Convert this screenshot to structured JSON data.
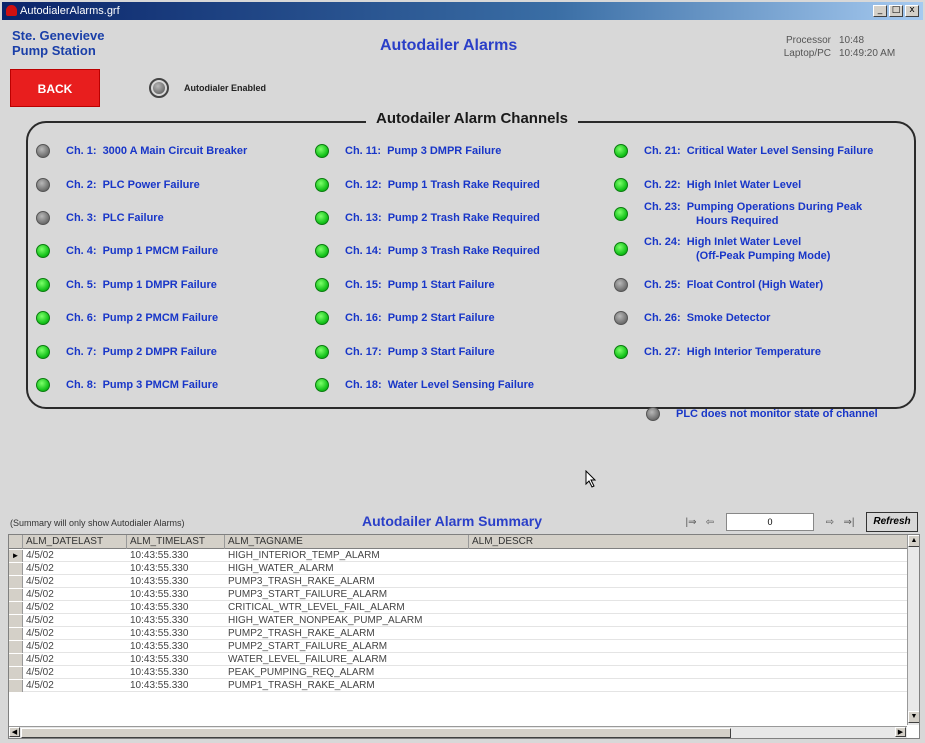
{
  "window": {
    "title": "AutodialerAlarms.grf",
    "min_label": "_",
    "max_label": "□",
    "close_label": "x"
  },
  "header": {
    "station_line1": "Ste. Genevieve",
    "station_line2": "Pump Station",
    "title": "Autodailer Alarms",
    "processor_label": "Processor",
    "laptop_label": "Laptop/PC",
    "processor_time": "10:48",
    "laptop_time": "10:49:20 AM"
  },
  "controls": {
    "back_label": "BACK",
    "enabled_label": "Autodialer Enabled"
  },
  "panel": {
    "title": "Autodailer Alarm Channels",
    "legend_text": "PLC does not monitor state of channel",
    "channels": [
      {
        "num": "Ch. 1:",
        "label": "3000 A Main Circuit Breaker",
        "state": "grey"
      },
      {
        "num": "Ch. 2:",
        "label": "PLC Power Failure",
        "state": "grey"
      },
      {
        "num": "Ch. 3:",
        "label": "PLC Failure",
        "state": "grey"
      },
      {
        "num": "Ch. 4:",
        "label": "Pump 1 PMCM Failure",
        "state": "green"
      },
      {
        "num": "Ch. 5:",
        "label": "Pump 1 DMPR Failure",
        "state": "green"
      },
      {
        "num": "Ch. 6:",
        "label": "Pump 2 PMCM Failure",
        "state": "green"
      },
      {
        "num": "Ch. 7:",
        "label": "Pump 2 DMPR Failure",
        "state": "green"
      },
      {
        "num": "Ch. 8:",
        "label": "Pump 3 PMCM Failure",
        "state": "green"
      },
      {
        "num": "Ch. 11:",
        "label": "Pump 3 DMPR Failure",
        "state": "green"
      },
      {
        "num": "Ch. 12:",
        "label": "Pump 1 Trash Rake Required",
        "state": "green"
      },
      {
        "num": "Ch. 13:",
        "label": "Pump 2 Trash Rake Required",
        "state": "green"
      },
      {
        "num": "Ch. 14:",
        "label": "Pump 3 Trash Rake Required",
        "state": "green"
      },
      {
        "num": "Ch. 15:",
        "label": "Pump 1 Start Failure",
        "state": "green"
      },
      {
        "num": "Ch. 16:",
        "label": "Pump 2 Start Failure",
        "state": "green"
      },
      {
        "num": "Ch. 17:",
        "label": "Pump 3 Start Failure",
        "state": "green"
      },
      {
        "num": "Ch. 18:",
        "label": "Water Level Sensing Failure",
        "state": "green"
      },
      {
        "num": "Ch. 21:",
        "label": "Critical Water Level Sensing Failure",
        "state": "green"
      },
      {
        "num": "Ch. 22:",
        "label": "High Inlet Water Level",
        "state": "green"
      },
      {
        "num": "Ch. 23:",
        "label": "Pumping Operations During Peak",
        "label2": "Hours Required",
        "state": "green"
      },
      {
        "num": "Ch. 24:",
        "label": "High Inlet Water Level",
        "label2": "(Off-Peak Pumping Mode)",
        "state": "green"
      },
      {
        "num": "Ch. 25:",
        "label": "Float Control (High Water)",
        "state": "grey"
      },
      {
        "num": "Ch. 26:",
        "label": "Smoke Detector",
        "state": "grey"
      },
      {
        "num": "Ch. 27:",
        "label": "High Interior Temperature",
        "state": "green"
      }
    ]
  },
  "summary": {
    "note": "(Summary will only show Autodialer Alarms)",
    "title": "Autodailer Alarm Summary",
    "page_value": "0",
    "refresh_label": "Refresh",
    "nav_first": "|⇒",
    "nav_prev": "⇦",
    "nav_next": "⇨",
    "nav_last": "⇒|",
    "columns": [
      "ALM_DATELAST",
      "ALM_TIMELAST",
      "ALM_TAGNAME",
      "ALM_DESCR"
    ],
    "rows": [
      [
        "4/5/02",
        "10:43:55.330",
        "HIGH_INTERIOR_TEMP_ALARM",
        ""
      ],
      [
        "4/5/02",
        "10:43:55.330",
        "HIGH_WATER_ALARM",
        ""
      ],
      [
        "4/5/02",
        "10:43:55.330",
        "PUMP3_TRASH_RAKE_ALARM",
        ""
      ],
      [
        "4/5/02",
        "10:43:55.330",
        "PUMP3_START_FAILURE_ALARM",
        ""
      ],
      [
        "4/5/02",
        "10:43:55.330",
        "CRITICAL_WTR_LEVEL_FAIL_ALARM",
        ""
      ],
      [
        "4/5/02",
        "10:43:55.330",
        "HIGH_WATER_NONPEAK_PUMP_ALARM",
        ""
      ],
      [
        "4/5/02",
        "10:43:55.330",
        "PUMP2_TRASH_RAKE_ALARM",
        ""
      ],
      [
        "4/5/02",
        "10:43:55.330",
        "PUMP2_START_FAILURE_ALARM",
        ""
      ],
      [
        "4/5/02",
        "10:43:55.330",
        "WATER_LEVEL_FAILURE_ALARM",
        ""
      ],
      [
        "4/5/02",
        "10:43:55.330",
        "PEAK_PUMPING_REQ_ALARM",
        ""
      ],
      [
        "4/5/02",
        "10:43:55.330",
        "PUMP1_TRASH_RAKE_ALARM",
        ""
      ]
    ]
  },
  "colors": {
    "green": "#14c21a",
    "grey": "#6e6e6e",
    "title_blue": "#2a3fc8",
    "back_red": "#e81e1e"
  }
}
